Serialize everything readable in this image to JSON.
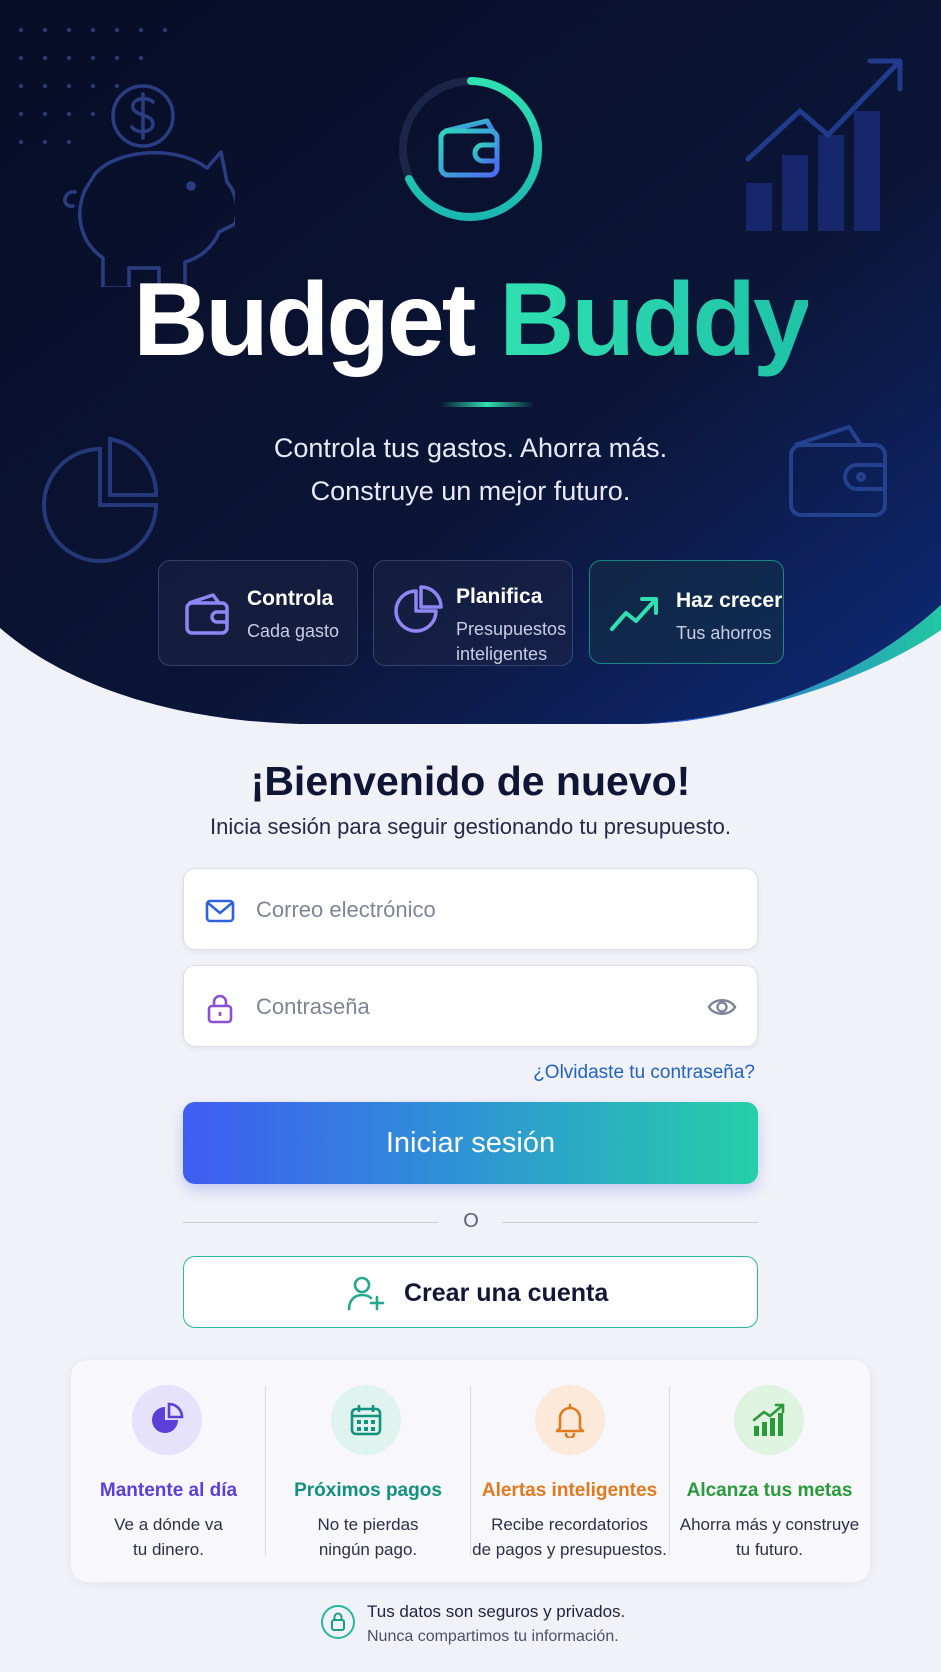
{
  "brand": {
    "word1": "Budget",
    "word2": "Buddy"
  },
  "tagline": {
    "line1": "Controla tus gastos. Ahorra más.",
    "line2": "Construye un mejor futuro."
  },
  "features": [
    {
      "title": "Controla",
      "subtitle": "Cada gasto",
      "icon": "wallet-icon"
    },
    {
      "title": "Planifica",
      "subtitle": "Presupuestos inteligentes",
      "icon": "pie-chart-icon"
    },
    {
      "title": "Haz crecer",
      "subtitle": "Tus ahorros",
      "icon": "trend-up-icon"
    }
  ],
  "login": {
    "title": "¡Bienvenido de nuevo!",
    "subtitle": "Inicia sesión para seguir gestionando tu presupuesto.",
    "email_placeholder": "Correo electrónico",
    "password_placeholder": "Contraseña",
    "forgot_label": "¿Olvidaste tu contraseña?",
    "submit_label": "Iniciar sesión",
    "divider_label": "O",
    "create_account_label": "Crear una cuenta"
  },
  "benefits": [
    {
      "title": "Mantente al día",
      "line1": "Ve a dónde va",
      "line2": "tu dinero.",
      "icon": "pie-chart-icon",
      "color": "#5b3fd6",
      "bg": "#e6e2fb"
    },
    {
      "title": "Próximos pagos",
      "line1": "No te pierdas",
      "line2": "ningún pago.",
      "icon": "calendar-icon",
      "color": "#14907f",
      "bg": "#dff4ef"
    },
    {
      "title": "Alertas inteligentes",
      "line1": "Recibe recordatorios",
      "line2": "de pagos y presupuestos.",
      "icon": "bell-icon",
      "color": "#e07a1f",
      "bg": "#fde9da"
    },
    {
      "title": "Alcanza tus metas",
      "line1": "Ahorra más y construye",
      "line2": "tu futuro.",
      "icon": "growth-chart-icon",
      "color": "#2a9a3a",
      "bg": "#dff3e1"
    }
  ],
  "security": {
    "line1": "Tus datos son seguros y privados.",
    "line2": "Nunca compartimos tu información."
  },
  "colors": {
    "hero_bg": "#0b1233",
    "accent_teal": "#2fe0b0",
    "accent_blue": "#3f5cf2",
    "link": "#2162c9"
  }
}
